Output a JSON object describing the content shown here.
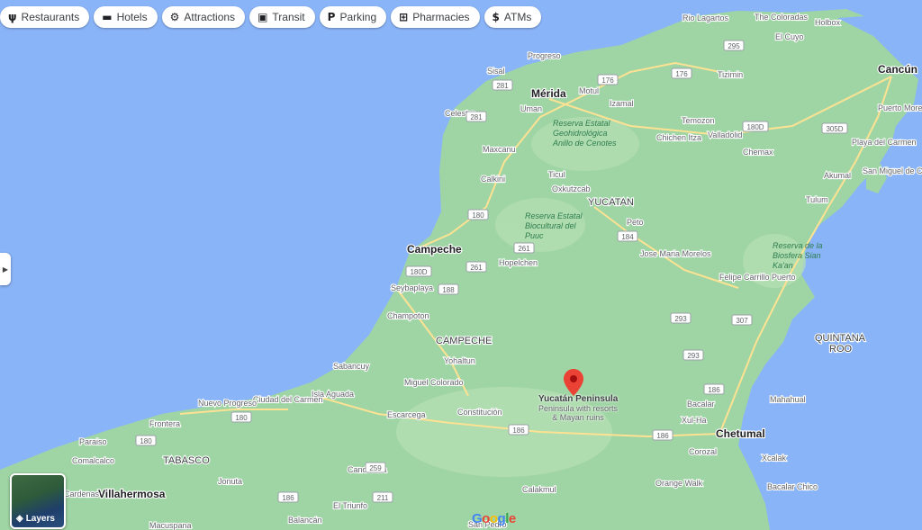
{
  "filter_chips": [
    {
      "label": "Restaurants",
      "icon": "restaurant-icon",
      "glyph": "ψ"
    },
    {
      "label": "Hotels",
      "icon": "bed-icon",
      "glyph": "▬"
    },
    {
      "label": "Attractions",
      "icon": "attraction-icon",
      "glyph": "⚙"
    },
    {
      "label": "Transit",
      "icon": "bus-icon",
      "glyph": "▣"
    },
    {
      "label": "Parking",
      "icon": "parking-icon",
      "glyph": "P"
    },
    {
      "label": "Pharmacies",
      "icon": "pharmacy-icon",
      "glyph": "⊞"
    },
    {
      "label": "ATMs",
      "icon": "atm-icon",
      "glyph": "$"
    }
  ],
  "layers_button": {
    "label": "Layers"
  },
  "pin": {
    "title": "Yucatán Peninsula",
    "subtitle": "Peninsula with resorts & Mayan ruins"
  },
  "logo_letters": [
    "G",
    "o",
    "o",
    "g",
    "l",
    "e"
  ],
  "colors": {
    "water": "#8ab4f8",
    "land": "#9fd5a4",
    "road": "#fde293",
    "pin": "#ea4335"
  },
  "states": [
    "YUCATAN",
    "CAMPECHE",
    "QUINTANA ROO",
    "TABASCO"
  ],
  "cities": [
    "Mérida",
    "Cancún",
    "Campeche",
    "Chetumal",
    "Villahermosa"
  ],
  "towns": [
    "Rio Lagartos",
    "The Coloradas",
    "Holbox",
    "El Cuyo",
    "Progreso",
    "Sisal",
    "Tizimin",
    "Motul",
    "Uman",
    "Izamal",
    "Celestun",
    "Temozon",
    "Puerto Morelos",
    "Maxcanu",
    "Chichen Itza",
    "Valladolid",
    "Playa del Carmen",
    "Chemax",
    "Ticul",
    "Calkini",
    "Oxkutzcab",
    "San Miguel de Cozumel",
    "Akumal",
    "Tulum",
    "Peto",
    "Hopelchen",
    "Jose Maria Morelos",
    "Seybaplaya",
    "Felipe Carrillo Puerto",
    "Champoton",
    "Sabancuy",
    "Yohaltun",
    "Isla Aguada",
    "Miguel Colorado",
    "Ciudad del Carmen",
    "Nuevo Progreso",
    "Escarcega",
    "Constitución",
    "Bacalar",
    "Mahahual",
    "Xul-Ha",
    "Frontera",
    "Paraiso",
    "Comalcalco",
    "Xcalak",
    "Candelaria",
    "Jonuta",
    "Corozal",
    "Orange Walk",
    "Bacalar Chico",
    "Calakmul",
    "El Triunfo",
    "Balancán",
    "Macuspana",
    "Cardenas",
    "San Pedro"
  ],
  "nature_labels": [
    "Reserva Estatal Geohidrológica Anillo de Cenotes",
    "Reserva Estatal Biocultural del Puuc",
    "Reserva de la Biosfera Sian Ka'an"
  ],
  "route_shields": [
    "295",
    "176",
    "281",
    "180",
    "180D",
    "305D",
    "261",
    "184",
    "188",
    "293",
    "307",
    "186",
    "259",
    "211"
  ]
}
